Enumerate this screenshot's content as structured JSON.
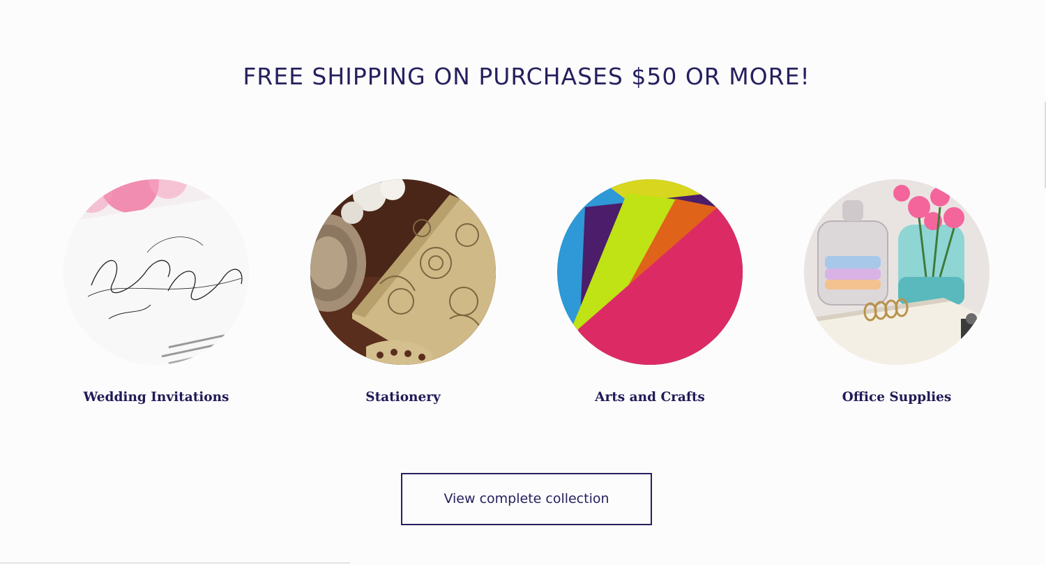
{
  "banner": {
    "text": "FREE SHIPPING ON PURCHASES $50 OR MORE!"
  },
  "categories": [
    {
      "label": "Wedding Invitations",
      "image": "wedding-invitation-card-image"
    },
    {
      "label": "Stationery",
      "image": "laser-cut-envelope-image"
    },
    {
      "label": "Arts and Crafts",
      "image": "colored-paper-sheets-image"
    },
    {
      "label": "Office Supplies",
      "image": "planner-and-flowers-image"
    }
  ],
  "cta": {
    "label": "View complete collection"
  },
  "colors": {
    "text_primary": "#25205e",
    "background": "#fcfcfc"
  }
}
